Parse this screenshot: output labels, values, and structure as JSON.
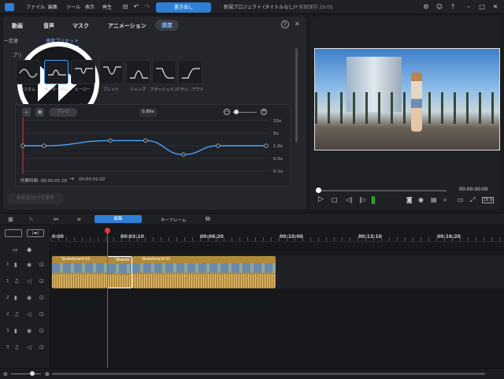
{
  "app": {
    "menu": [
      "ファイル",
      "編集",
      "ツール",
      "表示",
      "再生"
    ],
    "export_label": "書き出し",
    "title": "新規プロジェクト (タイトルなし)*",
    "saved": "前回保存 29:05"
  },
  "edit_panel": {
    "tabs": [
      "動画",
      "音声",
      "マスク",
      "アニメーション",
      "速度"
    ],
    "subtabs": [
      "一定速",
      "速度プリセット"
    ],
    "preset_section_label": "プリ",
    "presets": [
      {
        "label": "カスタム",
        "icon": "custom-curve-icon"
      },
      {
        "label": "モンタージュ",
        "icon": "montage-curve-icon"
      },
      {
        "label": "ヒーロー",
        "icon": "hero-curve-icon"
      },
      {
        "label": "ブレット",
        "icon": "bullet-curve-icon"
      },
      {
        "label": "ジャンプ",
        "icon": "jump-curve-icon"
      },
      {
        "label": "フラッシュイン",
        "icon": "flash-in-curve-icon"
      },
      {
        "label": "フラッ…アウト",
        "icon": "flash-out-curve-icon"
      }
    ],
    "preview_button": "プレビ",
    "current_speed": "0.89x",
    "y_ticks": [
      "10x",
      "5x",
      "1.0x",
      "0.5x",
      "0.1x"
    ],
    "duration_label": "所要時間: 00:00:01:18",
    "duration_after": "00:00:01:02",
    "apply_button": "名前を付けて保存",
    "curve_speeds": [
      1.0,
      1.0,
      1.6,
      1.6,
      0.45,
      1.0,
      1.0
    ]
  },
  "preview": {
    "timecode": "00:00:00:00",
    "aspect": "16:9"
  },
  "timeline_toolbar": {
    "tabs": [
      "編集",
      "キーフレーム"
    ]
  },
  "timeline": {
    "ruler": [
      "0:00",
      "00:03:10",
      "00:06:20",
      "00:10:00",
      "00:13:10",
      "00:16:20"
    ],
    "clip_name": "Skateboard 01",
    "clip_name_short": "Skateb",
    "track_numbers": [
      "1",
      "1",
      "2",
      "2",
      "3",
      "3"
    ]
  },
  "colors": {
    "accent": "#2f7fd6",
    "clip_video": "#b08a3b",
    "clip_audio": "#c79b2e",
    "playhead": "#e03a3a",
    "curve": "#4aa3ff"
  }
}
